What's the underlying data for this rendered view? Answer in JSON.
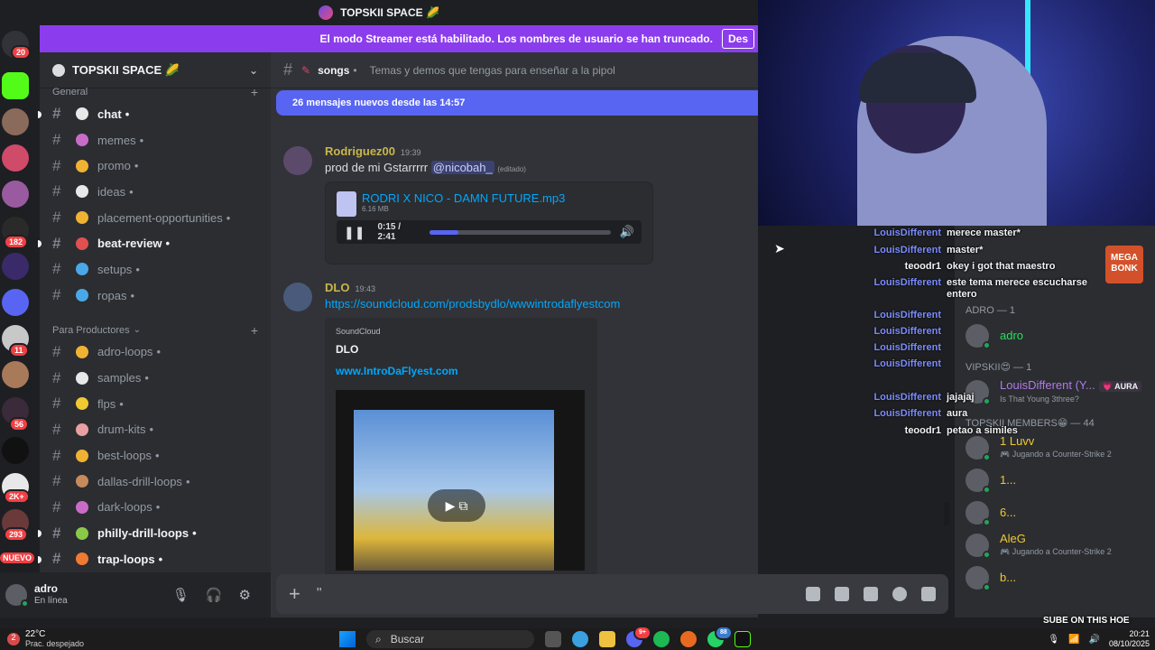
{
  "window": {
    "title": "TOPSKII SPACE 🌽"
  },
  "streamer_banner": {
    "text": "El modo Streamer está habilitado. Los nombres de usuario se han truncado.",
    "button": "Des"
  },
  "server_rail": {
    "badges": [
      "20",
      "182",
      "11",
      "56",
      "2K+",
      "293",
      "NUEVO"
    ]
  },
  "guild": {
    "name": "TOPSKII SPACE 🌽"
  },
  "sidebar": {
    "category_general": "General",
    "channels_general": [
      {
        "name": "chat",
        "unread": true,
        "color": "#e8e8e8"
      },
      {
        "name": "memes",
        "unread": false,
        "color": "#c86cc8"
      },
      {
        "name": "promo",
        "unread": false,
        "color": "#f0b232"
      },
      {
        "name": "ideas",
        "unread": false,
        "color": "#e8e8e8"
      },
      {
        "name": "placement-opportunities",
        "unread": false,
        "color": "#f0b232"
      },
      {
        "name": "beat-review",
        "unread": true,
        "color": "#e05050"
      },
      {
        "name": "setups",
        "unread": false,
        "color": "#4aa8e8"
      },
      {
        "name": "ropas",
        "unread": false,
        "color": "#4aa8e8"
      }
    ],
    "category_productores": "Para Productores",
    "channels_productores": [
      {
        "name": "adro-loops",
        "unread": false,
        "color": "#f0b232"
      },
      {
        "name": "samples",
        "unread": false,
        "color": "#e8e8e8"
      },
      {
        "name": "flps",
        "unread": false,
        "color": "#f0c832"
      },
      {
        "name": "drum-kits",
        "unread": false,
        "color": "#e8a0a0"
      },
      {
        "name": "best-loops",
        "unread": false,
        "color": "#f0b232"
      },
      {
        "name": "dallas-drill-loops",
        "unread": false,
        "color": "#c88a5a"
      },
      {
        "name": "dark-loops",
        "unread": false,
        "color": "#c86cc8"
      },
      {
        "name": "philly-drill-loops",
        "unread": true,
        "color": "#8ac84a"
      },
      {
        "name": "trap-loops",
        "unread": true,
        "color": "#f07a32"
      }
    ]
  },
  "user_panel": {
    "name": "adro",
    "status": "En línea"
  },
  "channel_header": {
    "name": "songs",
    "topic": "Temas y demos que tengas para enseñar a la pipol"
  },
  "new_messages": "26 mensajes nuevos desde las 14:57",
  "messages": [
    {
      "author": "Rodriguez00",
      "time": "19:39",
      "text": "prod de mi  Gstarrrrr",
      "mention": "@nicobah_",
      "edited": "(editado)",
      "attachment": {
        "name": "RODRI X NICO - DAMN FUTURE.mp3",
        "size": "6.16 MB",
        "time": "0:15 / 2:41",
        "progress": 0.16
      }
    },
    {
      "author": "DLO",
      "time": "19:43",
      "link": "https://soundcloud.com/prodsbydlo/wwwintrodaflyestcom",
      "embed": {
        "provider": "SoundCloud",
        "title": "DLO",
        "link": "www.IntroDaFlyest.com"
      }
    }
  ],
  "composer": {
    "placeholder": "\""
  },
  "stream_chat": [
    {
      "user": "LouisDifferent",
      "msg": "merece master*"
    },
    {
      "user": "LouisDifferent",
      "msg": "master*"
    },
    {
      "user": "teoodr1",
      "msg": "okey i got that maestro"
    },
    {
      "user": "LouisDifferent",
      "msg": "este tema merece escucharse entero"
    },
    {
      "user": "LouisDifferent",
      "msg": ""
    },
    {
      "user": "LouisDifferent",
      "msg": ""
    },
    {
      "user": "LouisDifferent",
      "msg": ""
    },
    {
      "user": "LouisDifferent",
      "msg": ""
    },
    {
      "user": "LouisDifferent",
      "msg": "jajajaj"
    },
    {
      "user": "LouisDifferent",
      "msg": "aura"
    },
    {
      "user": "teoodr1",
      "msg": "petao a similes"
    }
  ],
  "members": {
    "cat_adro": "ADRO — 1",
    "adro": "adro",
    "cat_vip": "VIPSKII😍 — 1",
    "vip_name": "LouisDifferent (Y...",
    "vip_tag": "💗 AURA",
    "vip_activity": "Is That Young 3three?",
    "cat_topskii": "TOPSKII MEMBERS😁 — 44",
    "list": [
      {
        "name": "1 Luvv",
        "activity": "🎮 Jugando a Counter-Strike 2",
        "color": "#f0c832"
      },
      {
        "name": "1...",
        "activity": "",
        "color": "#f0c832"
      },
      {
        "name": "6...",
        "activity": "",
        "color": "#f0c832"
      },
      {
        "name": "AleG",
        "activity": "🎮 Jugando a Counter-Strike 2",
        "color": "#f0c832"
      },
      {
        "name": "b...",
        "activity": "",
        "color": "#f0c832"
      }
    ]
  },
  "overlay": {
    "game": "MEGA BONK",
    "watermark": "SUBE ON THIS HOE"
  },
  "taskbar": {
    "temp": "22°C",
    "weather": "Prac. despejado",
    "weather_badge": "2",
    "search": "Buscar",
    "app_badge_discord": "9+",
    "app_badge_whatsapp": "88",
    "time": "20:21",
    "date": "08/10/2025"
  }
}
